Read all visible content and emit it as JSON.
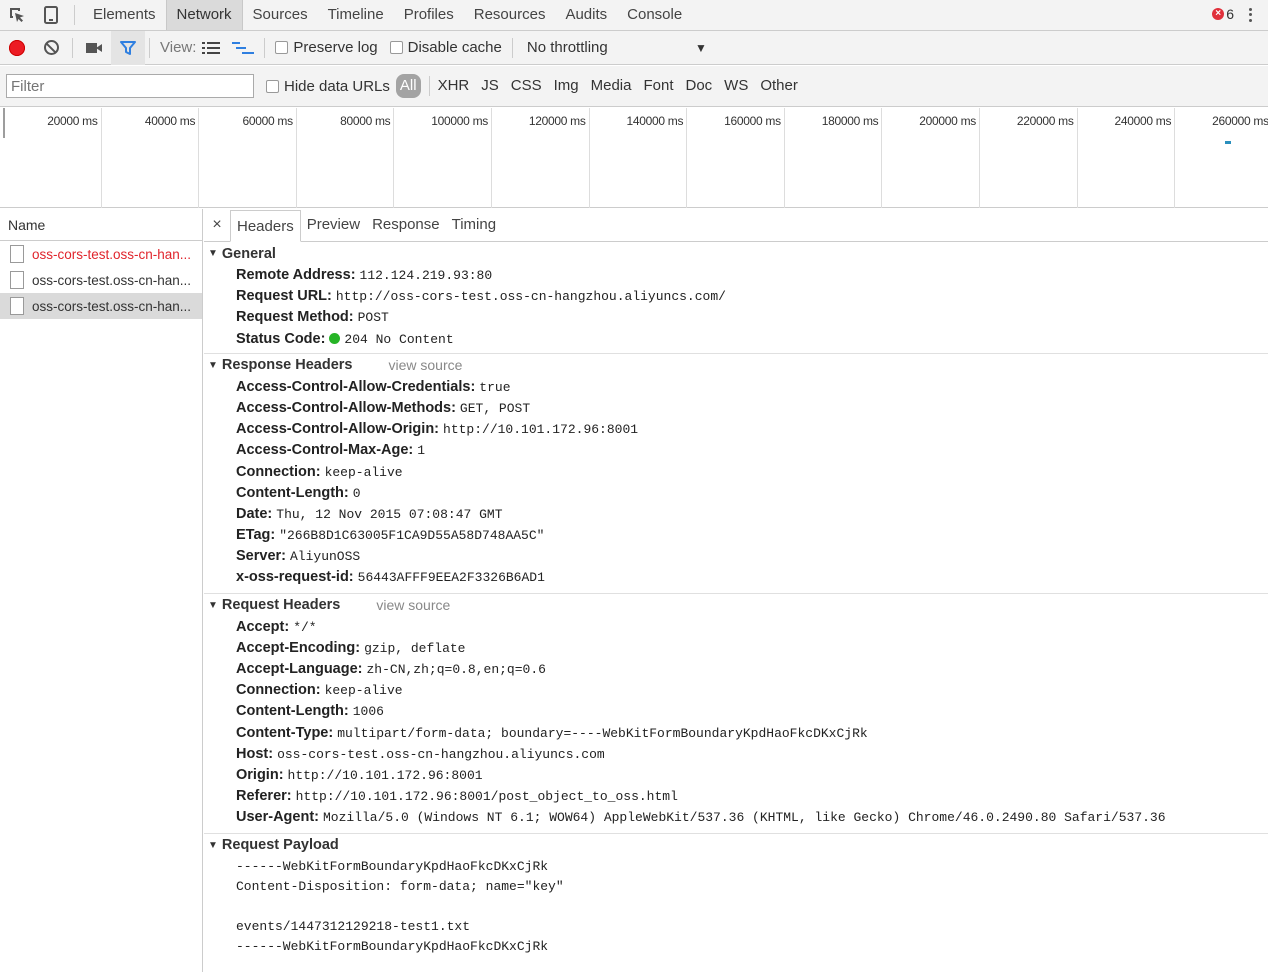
{
  "topbar": {
    "tabs": [
      "Elements",
      "Network",
      "Sources",
      "Timeline",
      "Profiles",
      "Resources",
      "Audits",
      "Console"
    ],
    "active_tab": "Network",
    "error_count": "6"
  },
  "toolbar": {
    "view_label": "View:",
    "preserve_log": "Preserve log",
    "disable_cache": "Disable cache",
    "throttling": "No throttling"
  },
  "filterbar": {
    "placeholder": "Filter",
    "hide_data_urls": "Hide data URLs",
    "types": [
      "All",
      "XHR",
      "JS",
      "CSS",
      "Img",
      "Media",
      "Font",
      "Doc",
      "WS",
      "Other"
    ]
  },
  "overview": {
    "ticks": [
      "20000 ms",
      "40000 ms",
      "60000 ms",
      "80000 ms",
      "100000 ms",
      "120000 ms",
      "140000 ms",
      "160000 ms",
      "180000 ms",
      "200000 ms",
      "220000 ms",
      "240000 ms",
      "260000 ms"
    ]
  },
  "requests": {
    "header": "Name",
    "items": [
      {
        "name": "oss-cors-test.oss-cn-han...",
        "state": "error"
      },
      {
        "name": "oss-cors-test.oss-cn-han...",
        "state": "normal"
      },
      {
        "name": "oss-cors-test.oss-cn-han...",
        "state": "selected"
      }
    ]
  },
  "details": {
    "close": "×",
    "tabs": [
      "Headers",
      "Preview",
      "Response",
      "Timing"
    ],
    "active_tab": "Headers",
    "general": {
      "title": "General",
      "rows": [
        {
          "k": "Remote Address:",
          "v": "112.124.219.93:80"
        },
        {
          "k": "Request URL:",
          "v": "http://oss-cors-test.oss-cn-hangzhou.aliyuncs.com/"
        },
        {
          "k": "Request Method:",
          "v": "POST"
        },
        {
          "k": "Status Code:",
          "v": "204 No Content"
        }
      ]
    },
    "response_headers": {
      "title": "Response Headers",
      "view_source": "view source",
      "rows": [
        {
          "k": "Access-Control-Allow-Credentials:",
          "v": "true"
        },
        {
          "k": "Access-Control-Allow-Methods:",
          "v": "GET, POST"
        },
        {
          "k": "Access-Control-Allow-Origin:",
          "v": "http://10.101.172.96:8001"
        },
        {
          "k": "Access-Control-Max-Age:",
          "v": "1"
        },
        {
          "k": "Connection:",
          "v": "keep-alive"
        },
        {
          "k": "Content-Length:",
          "v": "0"
        },
        {
          "k": "Date:",
          "v": "Thu, 12 Nov 2015 07:08:47 GMT"
        },
        {
          "k": "ETag:",
          "v": "\"266B8D1C63005F1CA9D55A58D748AA5C\""
        },
        {
          "k": "Server:",
          "v": "AliyunOSS"
        },
        {
          "k": "x-oss-request-id:",
          "v": "56443AFFF9EEA2F3326B6AD1"
        }
      ]
    },
    "request_headers": {
      "title": "Request Headers",
      "view_source": "view source",
      "rows": [
        {
          "k": "Accept:",
          "v": "*/*"
        },
        {
          "k": "Accept-Encoding:",
          "v": "gzip, deflate"
        },
        {
          "k": "Accept-Language:",
          "v": "zh-CN,zh;q=0.8,en;q=0.6"
        },
        {
          "k": "Connection:",
          "v": "keep-alive"
        },
        {
          "k": "Content-Length:",
          "v": "1006"
        },
        {
          "k": "Content-Type:",
          "v": "multipart/form-data; boundary=----WebKitFormBoundaryKpdHaoFkcDKxCjRk"
        },
        {
          "k": "Host:",
          "v": "oss-cors-test.oss-cn-hangzhou.aliyuncs.com"
        },
        {
          "k": "Origin:",
          "v": "http://10.101.172.96:8001"
        },
        {
          "k": "Referer:",
          "v": "http://10.101.172.96:8001/post_object_to_oss.html"
        },
        {
          "k": "User-Agent:",
          "v": "Mozilla/5.0 (Windows NT 6.1; WOW64) AppleWebKit/537.36 (KHTML, like Gecko) Chrome/46.0.2490.80 Safari/537.36"
        }
      ]
    },
    "payload": {
      "title": "Request Payload",
      "lines": [
        "------WebKitFormBoundaryKpdHaoFkcDKxCjRk",
        "Content-Disposition: form-data; name=\"key\"",
        "",
        "events/1447312129218-test1.txt",
        "------WebKitFormBoundaryKpdHaoFkcDKxCjRk"
      ]
    }
  }
}
